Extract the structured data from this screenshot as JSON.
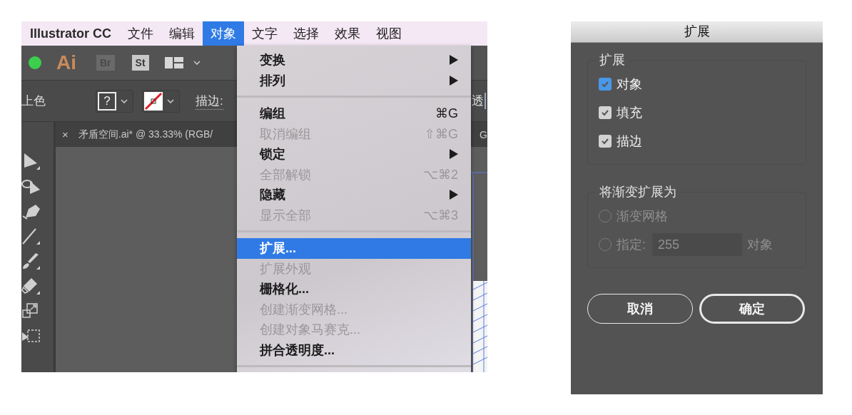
{
  "menubar": {
    "app_name": "Illustrator CC",
    "menus": [
      {
        "label": "文件",
        "selected": false
      },
      {
        "label": "编辑",
        "selected": false
      },
      {
        "label": "对象",
        "selected": true
      },
      {
        "label": "文字",
        "selected": false
      },
      {
        "label": "选择",
        "selected": false
      },
      {
        "label": "效果",
        "selected": false
      },
      {
        "label": "视图",
        "selected": false
      }
    ]
  },
  "toolbar": {
    "logo": "Ai",
    "bridge": "Br",
    "stock": "St",
    "mode_label": "上色",
    "fill_swatch": "?",
    "stroke_label": "描边:",
    "cut_label": "透"
  },
  "document_tab": {
    "close": "×",
    "title": "矛盾空间.ai* @ 33.33% (RGB/",
    "title_tail": "G"
  },
  "menu": {
    "items": [
      {
        "kind": "item",
        "label": "变换",
        "submenu": true,
        "disabled": false,
        "selected": false
      },
      {
        "kind": "item",
        "label": "排列",
        "submenu": true,
        "disabled": false,
        "selected": false
      },
      {
        "kind": "separator"
      },
      {
        "kind": "item",
        "label": "编组",
        "shortcut": "⌘G",
        "submenu": false,
        "disabled": false,
        "selected": false
      },
      {
        "kind": "item",
        "label": "取消编组",
        "shortcut": "⇧⌘G",
        "submenu": false,
        "disabled": true,
        "selected": false
      },
      {
        "kind": "item",
        "label": "锁定",
        "submenu": true,
        "disabled": false,
        "selected": false
      },
      {
        "kind": "item",
        "label": "全部解锁",
        "shortcut": "⌥⌘2",
        "submenu": false,
        "disabled": true,
        "selected": false
      },
      {
        "kind": "item",
        "label": "隐藏",
        "submenu": true,
        "disabled": false,
        "selected": false
      },
      {
        "kind": "item",
        "label": "显示全部",
        "shortcut": "⌥⌘3",
        "submenu": false,
        "disabled": true,
        "selected": false
      },
      {
        "kind": "separator"
      },
      {
        "kind": "item",
        "label": "扩展...",
        "submenu": false,
        "disabled": false,
        "selected": true
      },
      {
        "kind": "item",
        "label": "扩展外观",
        "submenu": false,
        "disabled": true,
        "selected": false
      },
      {
        "kind": "item",
        "label": "栅格化...",
        "submenu": false,
        "disabled": false,
        "selected": false
      },
      {
        "kind": "item",
        "label": "创建渐变网格...",
        "submenu": false,
        "disabled": true,
        "selected": false
      },
      {
        "kind": "item",
        "label": "创建对象马赛克...",
        "submenu": false,
        "disabled": true,
        "selected": false
      },
      {
        "kind": "item",
        "label": "拼合透明度...",
        "submenu": false,
        "disabled": false,
        "selected": false
      },
      {
        "kind": "separator"
      }
    ]
  },
  "dialog": {
    "title": "扩展",
    "groups": [
      {
        "legend": "扩展",
        "options": [
          {
            "kind": "checkbox",
            "label": "对象",
            "checked": true,
            "color": "#4a97e8"
          },
          {
            "kind": "checkbox",
            "label": "填充",
            "checked": true,
            "color": "#d2d2d2"
          },
          {
            "kind": "checkbox",
            "label": "描边",
            "checked": true,
            "color": "#d2d2d2"
          }
        ]
      },
      {
        "legend": "将渐变扩展为",
        "options": [
          {
            "kind": "radio",
            "label": "渐变网格",
            "selected": false,
            "disabled": true
          },
          {
            "kind": "radio",
            "label": "指定:",
            "selected": false,
            "disabled": true,
            "value": "255",
            "suffix": "对象"
          }
        ]
      }
    ],
    "buttons": [
      {
        "label": "取消",
        "default": false
      },
      {
        "label": "确定",
        "default": true
      }
    ]
  }
}
